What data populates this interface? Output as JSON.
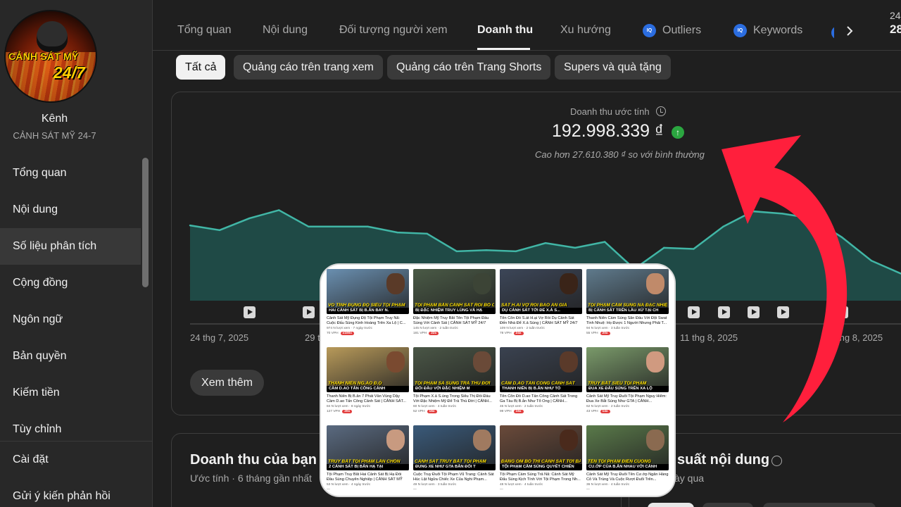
{
  "channel": {
    "avatar_text_line1": "CẢNH SÁT MỸ",
    "avatar_text_line2": "24/7",
    "title": "Kênh",
    "name": "CẢNH SÁT MỸ 24-7"
  },
  "sidebar": {
    "items": [
      {
        "label": "Tổng quan"
      },
      {
        "label": "Nội dung"
      },
      {
        "label": "Số liệu phân tích"
      },
      {
        "label": "Cộng đồng"
      },
      {
        "label": "Ngôn ngữ"
      },
      {
        "label": "Bản quyền"
      },
      {
        "label": "Kiếm tiền"
      },
      {
        "label": "Tùy chỉnh"
      }
    ],
    "bottom_items": [
      {
        "label": "Cài đặt"
      },
      {
        "label": "Gửi ý kiến phản hồi"
      }
    ]
  },
  "tabs": [
    {
      "label": "Tổng quan"
    },
    {
      "label": "Nội dung"
    },
    {
      "label": "Đối tượng người xem"
    },
    {
      "label": "Doanh thu"
    },
    {
      "label": "Xu hướng"
    },
    {
      "label": "Outliers",
      "badge": "IQ"
    },
    {
      "label": "Keywords",
      "badge": "IQ"
    }
  ],
  "corner": {
    "line1": "24",
    "line2": "28"
  },
  "chips": [
    {
      "label": "Tất cả"
    },
    {
      "label": "Quảng cáo trên trang xem"
    },
    {
      "label": "Quảng cáo trên Trang Shorts"
    },
    {
      "label": "Supers và quà tặng"
    }
  ],
  "metric": {
    "label": "Doanh thu ước tính",
    "value": "192.998.339 ₫",
    "compare": "Cao hơn 27.610.380 ₫ so với bình thường"
  },
  "chart_data": {
    "type": "area",
    "title": "",
    "x_ticks": [
      "24 thg 7, 2025",
      "29 th",
      "11 thg 8, 2025",
      "16 thg 8, 2025"
    ],
    "x_domain": [
      "2025-07-24",
      "2025-08-17"
    ],
    "x": [
      "2025-07-24",
      "2025-07-25",
      "2025-07-26",
      "2025-07-27",
      "2025-07-28",
      "2025-07-29",
      "2025-07-30",
      "2025-07-31",
      "2025-08-01",
      "2025-08-02",
      "2025-08-03",
      "2025-08-04",
      "2025-08-05",
      "2025-08-06",
      "2025-08-07",
      "2025-08-08",
      "2025-08-09",
      "2025-08-10",
      "2025-08-11",
      "2025-08-12",
      "2025-08-13",
      "2025-08-14",
      "2025-08-15",
      "2025-08-16",
      "2025-08-17"
    ],
    "values": [
      0.64,
      0.6,
      0.7,
      0.77,
      0.63,
      0.63,
      0.63,
      0.58,
      0.57,
      0.42,
      0.43,
      0.42,
      0.49,
      0.45,
      0.5,
      0.27,
      0.45,
      0.44,
      0.63,
      0.76,
      0.74,
      0.7,
      0.54,
      0.34,
      0.23
    ],
    "play_markers": [
      "2025-07-26",
      "2025-07-28",
      "2025-08-08",
      "2025-08-09",
      "2025-08-10",
      "2025-08-11",
      "2025-08-12",
      "2025-08-13",
      "2025-08-15"
    ],
    "colors": {
      "line": "#41b6a6",
      "fill": "#1f4a46"
    }
  },
  "see_more": "Xem thêm",
  "revenue_card": {
    "title": "Doanh thu của bạn",
    "subtitle": "Ước tính · 6 tháng gần nhất"
  },
  "perf_card": {
    "title": "suất nội dung",
    "subtitle": "ày qua"
  },
  "videos": [
    {
      "caption": "VÔ TÌNH ĐỤNG ĐỘ SIÊU TỘI PHẠM",
      "bar": "HAI CẢNH SÁT BỊ B.ẮN BAY N.",
      "title": "Cảnh Sát Mỹ Đụng Độ Tội Phạm Truy Nã: Cuộc Đấu Súng Kinh Hoàng Trên Xa Lộ | C...",
      "meta": "974 N lượt xem · 7 ngày trước",
      "b1": "70 VPH",
      "b2": "x100x",
      "bg": "#6a8fb0",
      "face": "#5a3a28"
    },
    {
      "caption": "TỘI PHẠM BẮN CẢNH SÁT RỒI BỎ CHẠY",
      "bar": "BỊ ĐẶC NHIỆM TRUY LÙNG VÀ HẠ",
      "title": "Đặc Nhiệm Mỹ Truy Bắt Tên Tội Phạm Đấu Súng Với Cảnh Sát | CẢNH SÁT MỸ 24/7",
      "meta": "145 N lượt xem · 2 tuần trước",
      "b1": "181 VPH",
      "b2": "22x",
      "bg": "#4a5a46",
      "face": "#3c4436"
    },
    {
      "caption": "SÁT H.AI VỢ RỒI BAO ÁN GIẢ",
      "bar": "DỤ CẢNH SÁT TỚI ĐỂ X.Ả S...",
      "title": "Tên Côn Đồ S.át H.ại Vợ Rồi Dụ Cảnh Sát Đến Nhà Để X.ả Súng | CẢNH SÁT MỸ 24/7",
      "meta": "109 N lượt xem · 2 tuần trước",
      "b1": "78 VPH",
      "b2": "24x",
      "bg": "#3c4658",
      "face": "#3a2418"
    },
    {
      "caption": "TỘI PHẠM CẦM SÚNG NÃ ĐẶC NHIỆM",
      "bar": "BỊ CẢNH SÁT TRÊN LẦU XỬ TẠI CH",
      "title": "Thanh Niên Cầm Súng Săn Đấu Với Đội Swat Tinh Nhuệ: Họ Được 1 Người Nhưng Phải T...",
      "meta": "94 N lượt xem · 3 tuần trước",
      "b1": "55 VPH",
      "b2": "20x",
      "bg": "#5f7a8c",
      "face": "#c08a6a"
    },
    {
      "caption": "THANH NIÊN NG.ÁO Đ.Ộ",
      "bar": "CẦM D.AO TẤN CÔNG CẢNH",
      "title": "Thanh Niên Bị B.ắn 7 Phát Vẫn Vùng Dậy Cầm D.ao Tấn Công Cảnh Sát | CẢNH SÁT...",
      "meta": "84 N lượt xem · 8 ngày trước",
      "b1": "127 VPH",
      "b2": "20x",
      "bg": "#b89a5a",
      "face": "#7a4a30"
    },
    {
      "caption": "TỘI PHẠM SẢ SÚNG TRẢ THÙ ĐỜI",
      "bar": "ĐỐI ĐẦU VỚI ĐẶC NHIỆM M",
      "title": "Tội Phạm X.ả S.úng Trong Siêu Thị Đối Đầu Với Đặc Nhiệm Mỹ Để Trả Thù Đời | CẢNH...",
      "meta": "60 N lượt xem · 4 tuần trước",
      "b1": "52 VPH",
      "b2": "16x",
      "bg": "#4a5646",
      "face": "#6a4a38"
    },
    {
      "caption": "CẦM D.AO TẤN CÔNG CẢNH SÁT",
      "bar": "THANH NIÊN BỊ B.ẮN NHƯ TỔ",
      "title": "Tên Côn Đồ D.ao Tấn Công Cảnh Sát Trong Ga Tàu Bị B.ắn Như Tổ Ong | CẢNH...",
      "meta": "46 N lượt xem · 2 tuần trước",
      "b1": "99 VPH",
      "b2": "16x",
      "bg": "#3a4250",
      "face": "#5a3a2a"
    },
    {
      "caption": "TRUY BẮT SIÊU TỘI PHẠM",
      "bar": "ĐUA XE ĐẤU SÚNG TRÊN XA LỘ",
      "title": "Cảnh Sát Mỹ Truy Đuổi Tội Phạm Nguy Hiểm: Đua Xe Bắt Súng Như GTA | CẢNH...",
      "meta": "62 N lượt xem · 2 tuần trước",
      "b1": "43 VPH",
      "b2": "14x",
      "bg": "#7a9a6a",
      "face": "#d09a80"
    },
    {
      "caption": "TRUY BẮT TỘI PHẠM LẨN CHỐN",
      "bar": "2 CẢNH SÁT BỊ BẮN HẠ TẠI",
      "title": "Tội Phạm Truy Bắt Hai Cảnh Sát Bị Hạ Đối Đầu Súng Chuyên Nghiệp | CẢNH SÁT MỸ 24/7",
      "meta": "53 N lượt xem · 4 ngày trước",
      "b1": "—",
      "b2": "",
      "bg": "#5a6a80",
      "face": "#c89a80"
    },
    {
      "caption": "CẢNH SÁT TRUY BẮT TỘI PHẠM",
      "bar": "ĐUNG XE NHƯ GTA BẮN ĐỐI T",
      "title": "Cuộc Truy Đuổi Tội Phạm Vũ Trang: Cảnh Sát Húc Lật Ngửa Chiếc Xe Của Nghi Phạm...",
      "meta": "49 N lượt xem · 3 tuần trước",
      "b1": "—",
      "b2": "",
      "bg": "#3a5a7a",
      "face": "#a07a60"
    },
    {
      "caption": "ĐANG ÔM BỐ THÌ CẢNH SÁT TỚI BẮT",
      "bar": "TỘI PHẠM CẦM SÚNG QUYẾT CHIẾN",
      "title": "Tội Phạm Cầm Súng Trả Nã: Cảnh Sát Mỹ Đấu Súng Kịch Tính Với Tội Phạm Trong Nh...",
      "meta": "48 N lượt xem · 4 tuần trước",
      "b1": "—",
      "b2": "",
      "bg": "#6a4a3a",
      "face": "#4a2a1c"
    },
    {
      "caption": "TÊN TỘI PHẠM ĐIÊN CUỒNG",
      "bar": "CU.ỚP CỦA B.ẮN NHAU VỚI CẢNH",
      "title": "Cảnh Sát Mỹ Truy Đuổi Tên Cư.ớp Ngân Hàng Cỏ Và Trùng Và Cuộc Rượt Đuổi Trên...",
      "meta": "36 N lượt xem · 4 tuần trước",
      "b1": "—",
      "b2": "",
      "bg": "#5a7a4a",
      "face": "#8a6a50"
    }
  ]
}
